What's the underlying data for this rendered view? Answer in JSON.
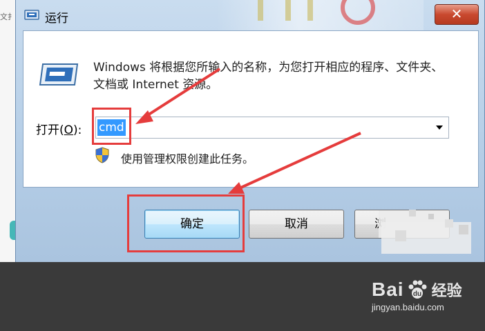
{
  "background": {
    "left_fragment_text": "文扌",
    "band_color": "#3a3a3a"
  },
  "window": {
    "title": "运行",
    "title_icon": "run-icon",
    "close_icon": "close-icon",
    "close_symbol": "✕"
  },
  "dialog": {
    "app_icon": "run-program-icon",
    "description": "Windows 将根据您所输入的名称，为您打开相应的程序、文件夹、文档或 Internet 资源。",
    "open_label_prefix": "打开(",
    "open_label_mnemonic": "O",
    "open_label_suffix": "):",
    "open_value": "cmd",
    "dropdown_icon": "chevron-down-icon",
    "admin_icon": "uac-shield-icon",
    "admin_text": "使用管理权限创建此任务。"
  },
  "buttons": {
    "ok_label": "确定",
    "cancel_label": "取消",
    "browse_label": "浏"
  },
  "annotation": {
    "color": "#e53c3c",
    "arrow_icon": "red-arrow-icon"
  },
  "watermark": {
    "brand": "Bai",
    "brand_du": "du",
    "product": "经验",
    "url": "jingyan.baidu.com"
  },
  "colors": {
    "selection": "#3399ff",
    "close_button": "#c9492f",
    "frame": "#b4cde6"
  }
}
